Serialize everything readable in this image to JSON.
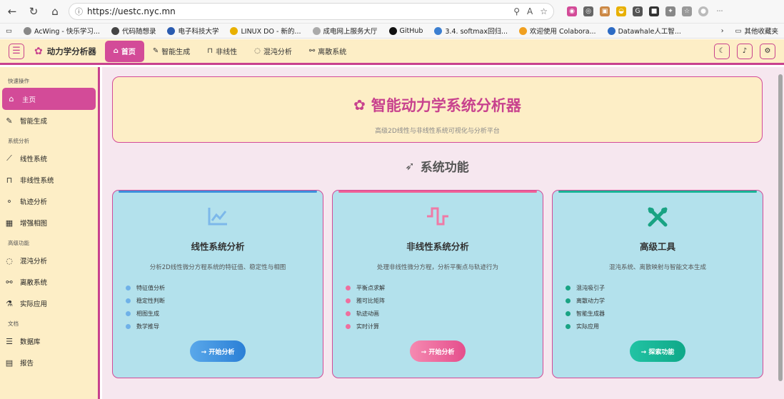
{
  "browser": {
    "url": "https://uestc.nyc.mn",
    "bookmarks": [
      "AcWing - 快乐学习...",
      "代码随想录",
      "电子科技大学",
      "LINUX DO - 新的...",
      "成电网上服务大厅",
      "GitHub",
      "3.4. softmax回归...",
      "欢迎使用 Colabora...",
      "Datawhale人工智..."
    ],
    "other_bookmarks": "其他收藏夹"
  },
  "app": {
    "brand": "动力学分析器",
    "tabs": [
      {
        "label": "首页",
        "icon": "home-icon"
      },
      {
        "label": "智能生成",
        "icon": "pen-icon"
      },
      {
        "label": "非线性",
        "icon": "wave-icon"
      },
      {
        "label": "混沌分析",
        "icon": "spinner-icon"
      },
      {
        "label": "离散系统",
        "icon": "network-icon"
      }
    ]
  },
  "sidebar": {
    "sections": [
      {
        "title": "快速操作",
        "items": [
          "主页",
          "智能生成"
        ]
      },
      {
        "title": "系统分析",
        "items": [
          "线性系统",
          "非线性系统",
          "轨迹分析",
          "增强相图"
        ]
      },
      {
        "title": "高级功能",
        "items": [
          "混沌分析",
          "离散系统",
          "实际应用"
        ]
      },
      {
        "title": "文档",
        "items": [
          "数据库",
          "报告"
        ]
      }
    ]
  },
  "hero": {
    "title": "智能动力学系统分析器",
    "subtitle": "高级2D线性与非线性系统可视化与分析平台"
  },
  "section_title": "系统功能",
  "cards": [
    {
      "title": "线性系统分析",
      "desc": "分析2D线性微分方程系统的特征值、稳定性与相图",
      "features": [
        "特征值分析",
        "稳定性判断",
        "相图生成",
        "数学推导"
      ],
      "button": "→ 开始分析",
      "accent": "#3d8fdb"
    },
    {
      "title": "非线性系统分析",
      "desc": "处理非线性微分方程，分析平衡点与轨迹行为",
      "features": [
        "平衡点求解",
        "雅可比矩阵",
        "轨迹动画",
        "实时计算"
      ],
      "button": "→ 开始分析",
      "accent": "#ef5f95"
    },
    {
      "title": "高级工具",
      "desc": "混沌系统、离散映射与智能文本生成",
      "features": [
        "混沌吸引子",
        "离散动力学",
        "智能生成器",
        "实际应用"
      ],
      "button": "→ 探索功能",
      "accent": "#19b295"
    }
  ]
}
